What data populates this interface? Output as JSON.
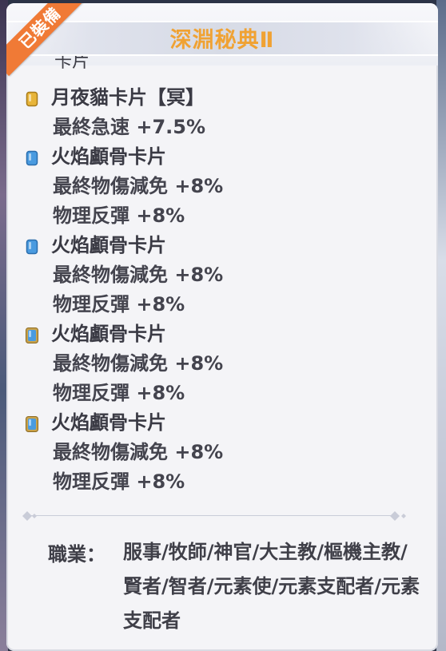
{
  "header": {
    "title": "深淵秘典Ⅱ",
    "ribbon": "已裝備",
    "partial_text": "卡片"
  },
  "cards": [
    {
      "name": "月夜貓卡片【冥】",
      "icon": "gold-card-icon",
      "icon_color": "#e8b53a",
      "stats": [
        "最終急速 +7.5%"
      ]
    },
    {
      "name": "火焰顱骨卡片",
      "icon": "blue-card-icon",
      "icon_color": "#4a9be0",
      "stats": [
        "最終物傷減免 +8%",
        "物理反彈 +8%"
      ]
    },
    {
      "name": "火焰顱骨卡片",
      "icon": "blue-card-icon",
      "icon_color": "#4a9be0",
      "stats": [
        "最終物傷減免 +8%",
        "物理反彈 +8%"
      ]
    },
    {
      "name": "火焰顱骨卡片",
      "icon": "blue-card-gold-frame-icon",
      "icon_color": "#4a9be0",
      "stats": [
        "最終物傷減免 +8%",
        "物理反彈 +8%"
      ]
    },
    {
      "name": "火焰顱骨卡片",
      "icon": "blue-card-gold-frame-icon",
      "icon_color": "#4a9be0",
      "stats": [
        "最終物傷減免 +8%",
        "物理反彈 +8%"
      ]
    }
  ],
  "jobs": {
    "label": "職業：",
    "value": "服事/牧師/神官/大主教/樞機主教/賢者/智者/元素使/元素支配者/元素支配者"
  },
  "colors": {
    "title": "#f0a233",
    "ribbon": "#f07a36",
    "text": "#3a3a44",
    "panel": "#f4f4f7"
  }
}
